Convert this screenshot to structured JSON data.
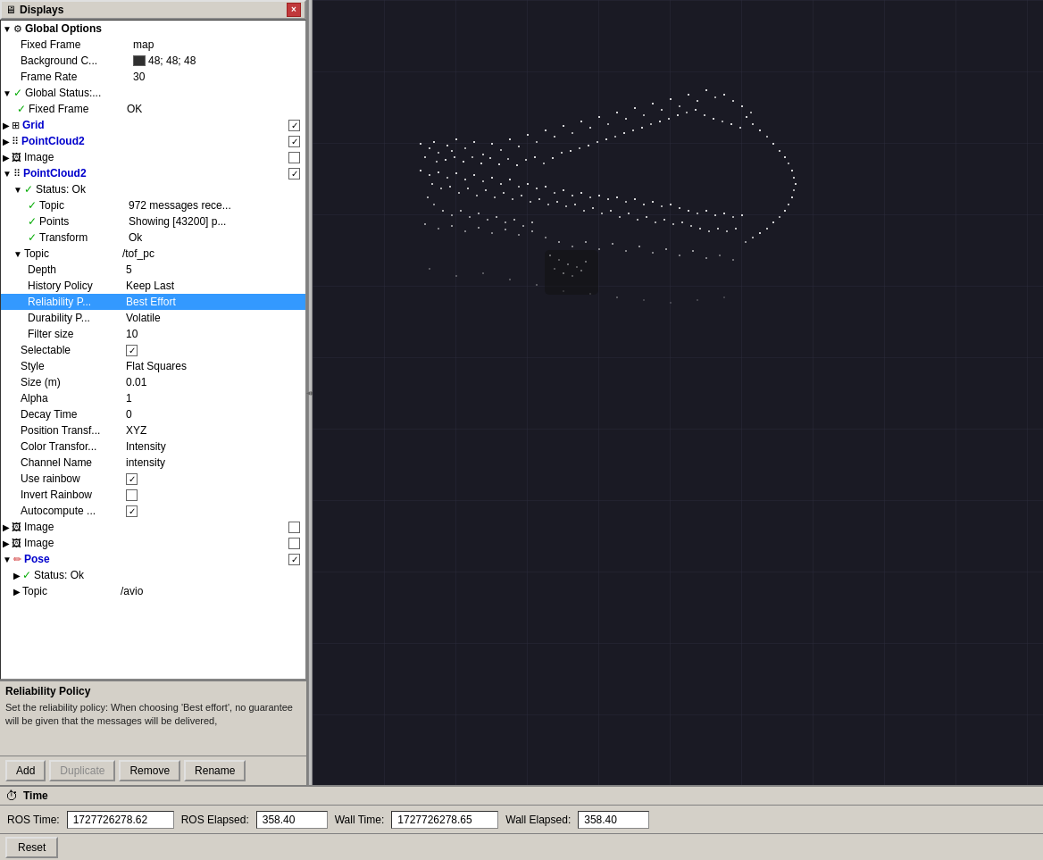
{
  "titlebar": {
    "icon": "🖥",
    "title": "Displays"
  },
  "displays_panel": {
    "header": "Displays",
    "close_btn": "×",
    "tree": [
      {
        "id": "global-options",
        "indent": 0,
        "expand": "▼",
        "prefix": "⚙",
        "label": "Global Options",
        "value": ""
      },
      {
        "id": "fixed-frame",
        "indent": 1,
        "label": "Fixed Frame",
        "value": "map"
      },
      {
        "id": "background-color",
        "indent": 1,
        "label": "Background C...",
        "value": "48; 48; 48",
        "has_swatch": true
      },
      {
        "id": "frame-rate",
        "indent": 1,
        "label": "Frame Rate",
        "value": "30"
      },
      {
        "id": "global-status",
        "indent": 0,
        "expand": "▼",
        "prefix": "✓",
        "prefix_class": "green-check",
        "label": "Global Status:...",
        "value": ""
      },
      {
        "id": "fixed-frame-status",
        "indent": 1,
        "prefix": "✓",
        "prefix_class": "green-check",
        "label": "Fixed Frame",
        "value": "OK"
      },
      {
        "id": "grid",
        "indent": 0,
        "expand": "▶",
        "prefix": "⊞",
        "label": "Grid",
        "label_class": "blue-label",
        "value": "",
        "has_check": true,
        "checked": true
      },
      {
        "id": "pointcloud2-1",
        "indent": 0,
        "expand": "▶",
        "prefix": "⠿",
        "label": "PointCloud2",
        "label_class": "blue-label",
        "value": "",
        "has_check": true,
        "checked": true
      },
      {
        "id": "image-1",
        "indent": 0,
        "expand": "▶",
        "prefix": "🖼",
        "label": "Image",
        "value": "",
        "has_check": true,
        "checked": false
      },
      {
        "id": "pointcloud2-2",
        "indent": 0,
        "expand": "▼",
        "prefix": "⠿",
        "label": "PointCloud2",
        "label_class": "blue-label",
        "value": "",
        "has_check": true,
        "checked": true
      },
      {
        "id": "status-ok",
        "indent": 1,
        "expand": "▼",
        "prefix": "✓",
        "prefix_class": "green-check",
        "label": "Status: Ok",
        "value": ""
      },
      {
        "id": "topic-status",
        "indent": 2,
        "prefix": "✓",
        "prefix_class": "green-check",
        "label": "Topic",
        "value": "972 messages rece..."
      },
      {
        "id": "points-status",
        "indent": 2,
        "prefix": "✓",
        "prefix_class": "green-check",
        "label": "Points",
        "value": "Showing [43200] p..."
      },
      {
        "id": "transform-status",
        "indent": 2,
        "prefix": "✓",
        "prefix_class": "green-check",
        "label": "Transform",
        "value": "Ok"
      },
      {
        "id": "topic",
        "indent": 1,
        "expand": "▼",
        "label": "Topic",
        "value": "/tof_pc"
      },
      {
        "id": "depth",
        "indent": 2,
        "label": "Depth",
        "value": "5"
      },
      {
        "id": "history-policy",
        "indent": 2,
        "label": "History Policy",
        "value": "Keep Last"
      },
      {
        "id": "reliability-policy",
        "indent": 2,
        "label": "Reliability P...",
        "value": "Best Effort",
        "selected": true
      },
      {
        "id": "durability-policy",
        "indent": 2,
        "label": "Durability P...",
        "value": "Volatile"
      },
      {
        "id": "filter-size",
        "indent": 2,
        "label": "Filter size",
        "value": "10"
      },
      {
        "id": "selectable",
        "indent": 1,
        "label": "Selectable",
        "value": "",
        "has_check": true,
        "checked": true
      },
      {
        "id": "style",
        "indent": 1,
        "label": "Style",
        "value": "Flat Squares"
      },
      {
        "id": "size-m",
        "indent": 1,
        "label": "Size (m)",
        "value": "0.01"
      },
      {
        "id": "alpha",
        "indent": 1,
        "label": "Alpha",
        "value": "1"
      },
      {
        "id": "decay-time",
        "indent": 1,
        "label": "Decay Time",
        "value": "0"
      },
      {
        "id": "position-transform",
        "indent": 1,
        "label": "Position Transf...",
        "value": "XYZ"
      },
      {
        "id": "color-transform",
        "indent": 1,
        "label": "Color Transfor...",
        "value": "Intensity"
      },
      {
        "id": "channel-name",
        "indent": 1,
        "label": "Channel Name",
        "value": "intensity"
      },
      {
        "id": "use-rainbow",
        "indent": 1,
        "label": "Use rainbow",
        "value": "",
        "has_check": true,
        "checked": true
      },
      {
        "id": "invert-rainbow",
        "indent": 1,
        "label": "Invert Rainbow",
        "value": "",
        "has_check": true,
        "checked": false
      },
      {
        "id": "autocompute",
        "indent": 1,
        "label": "Autocompute ...",
        "value": "",
        "has_check": true,
        "checked": true
      },
      {
        "id": "image-2",
        "indent": 0,
        "expand": "▶",
        "prefix": "🖼",
        "label": "Image",
        "value": "",
        "has_check": true,
        "checked": false
      },
      {
        "id": "image-3",
        "indent": 0,
        "expand": "▶",
        "prefix": "🖼",
        "label": "Image",
        "value": "",
        "has_check": true,
        "checked": false
      },
      {
        "id": "pose",
        "indent": 0,
        "expand": "▼",
        "prefix": "✏",
        "prefix_class": "red-x",
        "label": "Pose",
        "label_class": "blue-label",
        "value": "",
        "has_check": true,
        "checked": true
      },
      {
        "id": "pose-status",
        "indent": 1,
        "expand": "▶",
        "prefix": "✓",
        "prefix_class": "green-check",
        "label": "Status: Ok",
        "value": ""
      },
      {
        "id": "topic-pose",
        "indent": 1,
        "label": "Topic",
        "value": "/avio"
      }
    ]
  },
  "description": {
    "title": "Reliability Policy",
    "text": "Set the reliability policy: When choosing 'Best effort', no guarantee will be given that the messages will be delivered,"
  },
  "buttons": {
    "add": "Add",
    "duplicate": "Duplicate",
    "remove": "Remove",
    "rename": "Rename"
  },
  "bottom_bar": {
    "icon": "⏱",
    "title": "Time"
  },
  "status_bar": {
    "ros_time_label": "ROS Time:",
    "ros_time_value": "1727726278.62",
    "ros_elapsed_label": "ROS Elapsed:",
    "ros_elapsed_value": "358.40",
    "wall_time_label": "Wall Time:",
    "wall_time_value": "1727726278.65",
    "wall_elapsed_label": "Wall Elapsed:",
    "wall_elapsed_value": "358.40"
  },
  "reset_btn": "Reset"
}
